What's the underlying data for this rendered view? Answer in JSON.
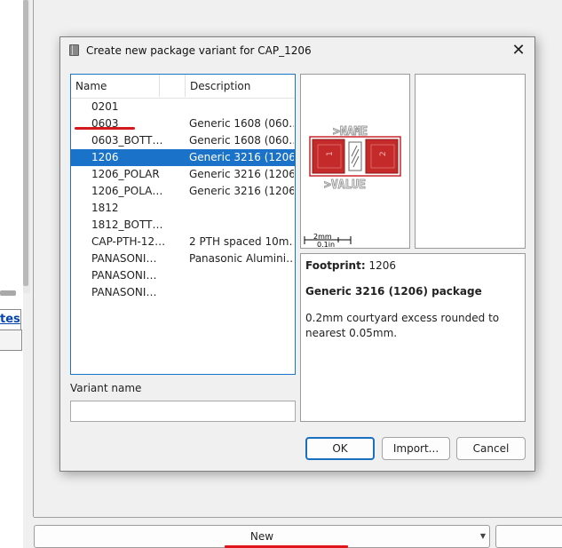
{
  "background": {
    "link_text": "tes",
    "combo_value": "New"
  },
  "dialog": {
    "title": "Create new package variant for CAP_1206",
    "columns": {
      "name": "Name",
      "description": "Description"
    },
    "rows": [
      {
        "name": "0201",
        "description": "",
        "selected": false
      },
      {
        "name": "0603",
        "description": "Generic 1608 (060…",
        "selected": false
      },
      {
        "name": "0603_BOTT…",
        "description": "Generic 1608 (060…",
        "selected": false
      },
      {
        "name": "1206",
        "description": "Generic 3216 (1206…",
        "selected": true
      },
      {
        "name": "1206_POLAR",
        "description": "Generic 3216 (1206…",
        "selected": false
      },
      {
        "name": "1206_POLA…",
        "description": "Generic 3216 (1206…",
        "selected": false
      },
      {
        "name": "1812",
        "description": "",
        "selected": false
      },
      {
        "name": "1812_BOTT…",
        "description": "",
        "selected": false
      },
      {
        "name": "CAP-PTH-12…",
        "description": "2 PTH spaced 10m…",
        "selected": false
      },
      {
        "name": "PANASONI…",
        "description": "Panasonic Alumini…",
        "selected": false
      },
      {
        "name": "PANASONI…",
        "description": "",
        "selected": false
      },
      {
        "name": "PANASONI…",
        "description": "",
        "selected": false
      }
    ],
    "variant_name_label": "Variant name",
    "variant_name_value": "",
    "preview": {
      "name_text": ">NAME",
      "value_text": ">VALUE",
      "pad1": "1",
      "pad2": "2",
      "scale_top": "2mm",
      "scale_bottom": "0.1in",
      "pad_color": "#d42a2a"
    },
    "info": {
      "footprint_label": "Footprint:",
      "footprint_value": "1206",
      "title": "Generic 3216 (1206) package",
      "description": "0.2mm courtyard excess rounded to nearest 0.05mm."
    },
    "buttons": {
      "ok": "OK",
      "import": "Import...",
      "cancel": "Cancel"
    }
  }
}
